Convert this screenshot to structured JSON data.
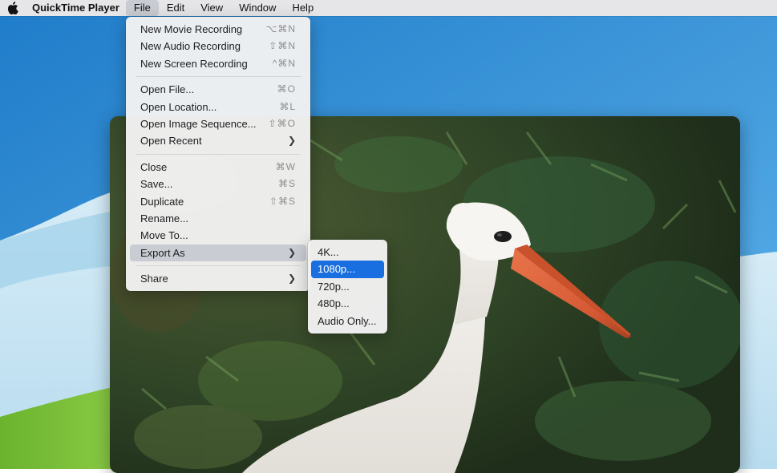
{
  "menubar": {
    "apple_icon": "apple-logo-icon",
    "app_name": "QuickTime Player",
    "items": [
      "File",
      "Edit",
      "View",
      "Window",
      "Help"
    ],
    "active": "File"
  },
  "file_menu": {
    "group1": [
      {
        "label": "New Movie Recording",
        "shortcut": "⌥⌘N"
      },
      {
        "label": "New Audio Recording",
        "shortcut": "⇧⌘N"
      },
      {
        "label": "New Screen Recording",
        "shortcut": "^⌘N"
      }
    ],
    "group2": [
      {
        "label": "Open File...",
        "shortcut": "⌘O"
      },
      {
        "label": "Open Location...",
        "shortcut": "⌘L"
      },
      {
        "label": "Open Image Sequence...",
        "shortcut": "⇧⌘O"
      },
      {
        "label": "Open Recent",
        "submenu_icon": "chevron-right-icon"
      }
    ],
    "group3": [
      {
        "label": "Close",
        "shortcut": "⌘W"
      },
      {
        "label": "Save...",
        "shortcut": "⌘S"
      },
      {
        "label": "Duplicate",
        "shortcut": "⇧⌘S"
      },
      {
        "label": "Rename..."
      },
      {
        "label": "Move To..."
      },
      {
        "label": "Export As",
        "submenu_icon": "chevron-right-icon",
        "highlighted": true
      }
    ],
    "group4": [
      {
        "label": "Share",
        "submenu_icon": "chevron-right-icon"
      }
    ]
  },
  "export_submenu": {
    "items": [
      "4K...",
      "1080p...",
      "720p...",
      "480p...",
      "Audio Only..."
    ],
    "selected": "1080p..."
  },
  "colors": {
    "selection": "#1a6fe0",
    "menu_highlight": "#c9cdd3",
    "desktop_blue": "#3a90d6"
  }
}
